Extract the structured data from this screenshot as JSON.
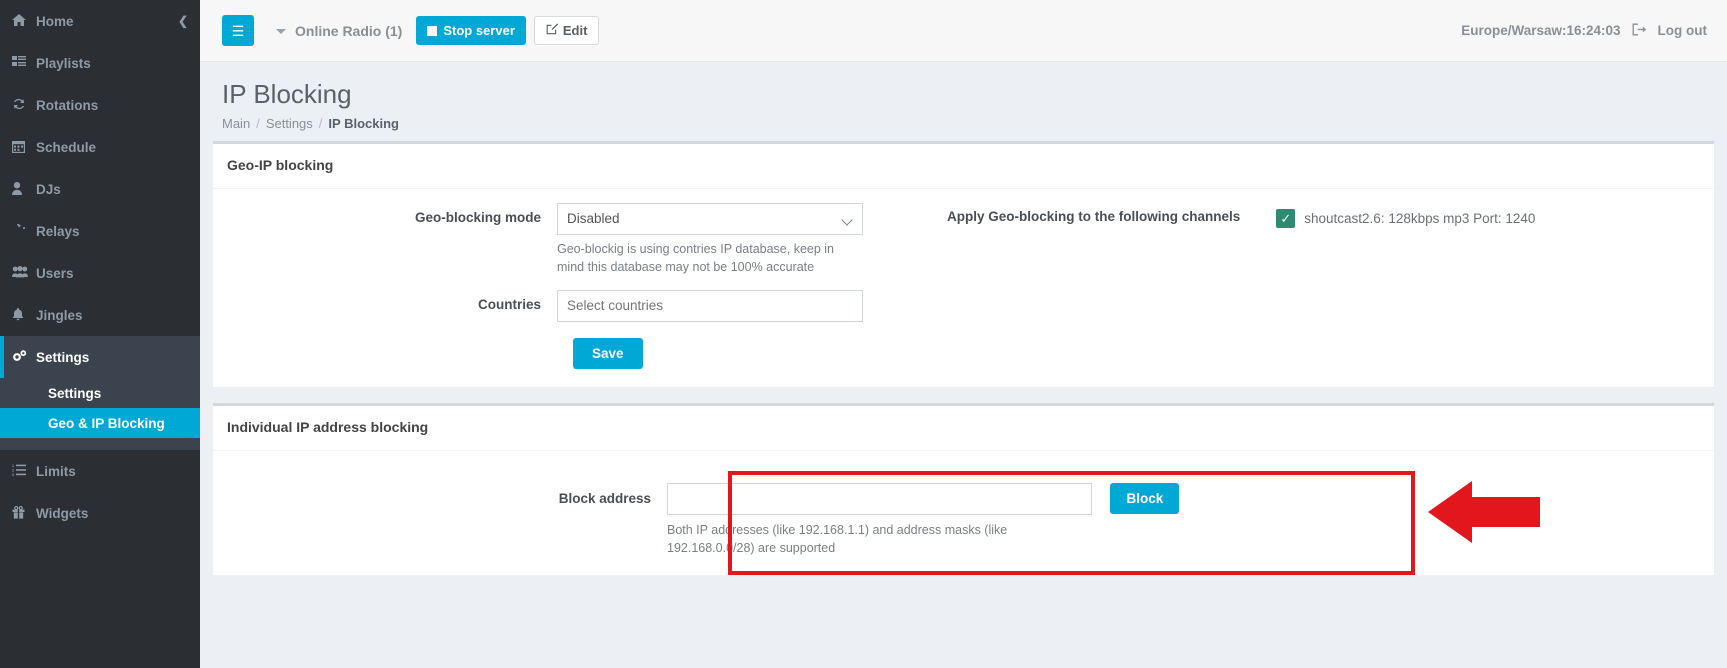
{
  "sidebar": {
    "collapse_icon": "chevron-left-icon",
    "items": [
      {
        "label": "Home",
        "icon": "home-icon",
        "glyph": "⌂"
      },
      {
        "label": "Playlists",
        "icon": "list-icon",
        "glyph": "☰"
      },
      {
        "label": "Rotations",
        "icon": "refresh-icon",
        "glyph": "↻"
      },
      {
        "label": "Schedule",
        "icon": "calendar-icon",
        "glyph": "Ὄ5"
      },
      {
        "label": "DJs",
        "icon": "user-icon",
        "glyph": "♟"
      },
      {
        "label": "Relays",
        "icon": "rotate-icon",
        "glyph": "⟳"
      },
      {
        "label": "Users",
        "icon": "users-icon",
        "glyph": "὆5"
      },
      {
        "label": "Jingles",
        "icon": "bell-icon",
        "glyph": "ὑ4"
      }
    ],
    "settings": {
      "label": "Settings",
      "icon": "gears-icon",
      "children": [
        {
          "label": "Settings",
          "selected": false
        },
        {
          "label": "Geo & IP Blocking",
          "selected": true
        }
      ]
    },
    "items_after": [
      {
        "label": "Limits",
        "icon": "ordered-list-icon",
        "glyph": "☰"
      },
      {
        "label": "Widgets",
        "icon": "gift-icon",
        "glyph": "☂"
      }
    ]
  },
  "topbar": {
    "menu_toggle_icon": "hamburger-icon",
    "station_name": "Online Radio (1)",
    "stop_server_label": "Stop server",
    "edit_label": "Edit",
    "edit_icon": "pencil-square-icon",
    "clock": "Europe/Warsaw:16:24:03",
    "logout_icon": "sign-out-icon",
    "logout_label": "Log out"
  },
  "page": {
    "title": "IP Blocking",
    "breadcrumb": [
      {
        "label": "Main"
      },
      {
        "label": "Settings"
      },
      {
        "label": "IP Blocking"
      }
    ]
  },
  "geo_panel": {
    "title": "Geo-IP blocking",
    "mode_label": "Geo-blocking mode",
    "mode_value": "Disabled",
    "mode_options": [
      "Disabled"
    ],
    "mode_help": "Geo-blockig is using contries IP database, keep in mind this database may not be 100% accurate",
    "countries_label": "Countries",
    "countries_placeholder": "Select countries",
    "countries_value": "",
    "save_label": "Save",
    "channels_label": "Apply Geo-blocking to the following channels",
    "channels": [
      {
        "label": "shoutcast2.6: 128kbps mp3 Port: 1240",
        "checked": true,
        "check_glyph": "✓"
      }
    ]
  },
  "ip_panel": {
    "title": "Individual IP address blocking",
    "block_label": "Block address",
    "block_value": "",
    "block_placeholder": "",
    "block_button": "Block",
    "block_help": "Both IP addresses (like 192.168.1.1) and address masks (like 192.168.0.0/28) are supported"
  },
  "annotations": {
    "highlight_color": "#e3161c",
    "arrow_color": "#e3161c",
    "arrow_direction": "left"
  },
  "colors": {
    "accent": "#00a8d6",
    "sidebar_bg": "#2b2e33",
    "sidebar_active": "#3b444e",
    "checkbox_green": "#2e8b72",
    "page_bg": "#ecf0f5"
  }
}
